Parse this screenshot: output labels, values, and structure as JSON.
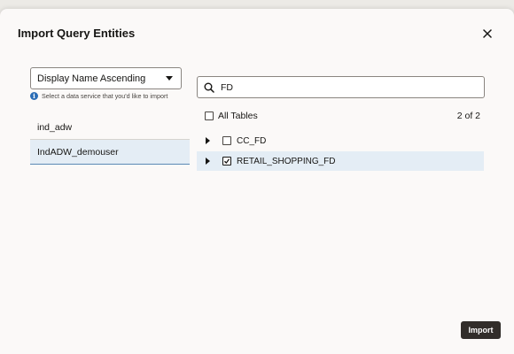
{
  "dialog": {
    "title": "Import Query Entities",
    "close_icon": "close-icon"
  },
  "sort": {
    "selected": "Display Name Ascending"
  },
  "helper": {
    "text": "Select a data service that you'd like to import",
    "icon": "info-icon"
  },
  "services": [
    {
      "label": "ind_adw",
      "selected": false
    },
    {
      "label": "IndADW_demouser",
      "selected": true
    }
  ],
  "search": {
    "value": "FD",
    "icon": "search-icon"
  },
  "tables": {
    "all_label": "All Tables",
    "all_checked": false,
    "count": "2 of 2",
    "items": [
      {
        "label": "CC_FD",
        "checked": false,
        "selected": false
      },
      {
        "label": "RETAIL_SHOPPING_FD",
        "checked": true,
        "selected": true
      }
    ]
  },
  "footer": {
    "import_label": "Import"
  },
  "colors": {
    "primary_button": "#312d2a",
    "selection": "#e4edf5",
    "info": "#2b6db5"
  }
}
